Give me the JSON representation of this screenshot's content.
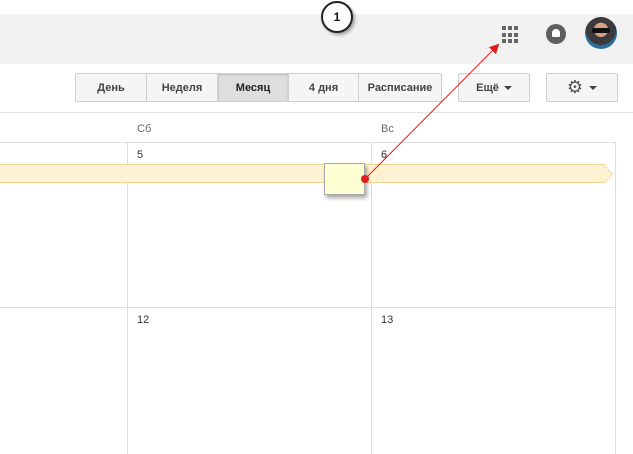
{
  "header": {
    "apps_icon": "apps-grid-icon",
    "notifications_icon": "notifications-icon",
    "avatar_icon": "user-avatar"
  },
  "toolbar": {
    "views": [
      {
        "label": "День",
        "active": false
      },
      {
        "label": "Неделя",
        "active": false
      },
      {
        "label": "Месяц",
        "active": true
      },
      {
        "label": "4 дня",
        "active": false
      },
      {
        "label": "Расписание",
        "active": false
      }
    ],
    "more_label": "Ещё",
    "settings_icon": "gear-icon"
  },
  "calendar": {
    "weekdays": [
      "Сб",
      "Вс"
    ],
    "weeks": [
      {
        "days": [
          "5",
          "6"
        ]
      },
      {
        "days": [
          "12",
          "13"
        ]
      }
    ]
  },
  "annotation": {
    "callout_number": "1",
    "arrow_color": "#e02020"
  }
}
